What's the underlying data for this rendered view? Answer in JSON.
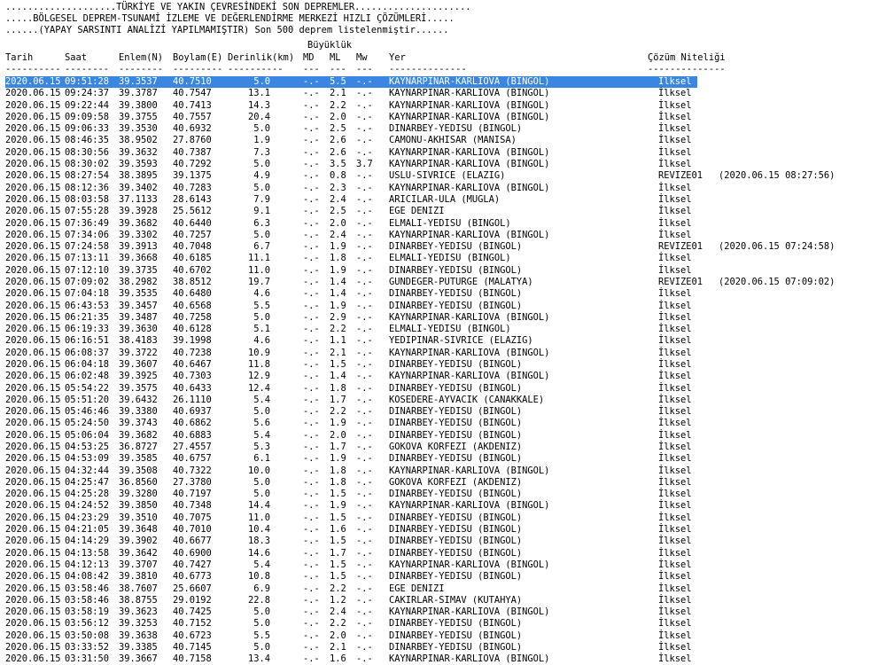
{
  "banner": [
    "....................TÜRKİYE VE YAKIN ÇEVRESİNDEKİ SON DEPREMLER.....................",
    ".....BÖLGESEL DEPREM-TSUNAMİ İZLEME VE DEĞERLENDİRME MERKEZİ HIZLI ÇÖZÜMLERİ.....",
    "......(YAPAY SARSINTI ANALİZİ YAPILMAMIŞTIR) Son 500 deprem listelenmiştir......"
  ],
  "magnitude_group": "Büyüklük",
  "headers": {
    "date": "Tarih",
    "time": "Saat",
    "lat": "Enlem(N)",
    "lon": "Boylam(E)",
    "depth": "Derinlik(km)",
    "md": "MD",
    "ml": "ML",
    "mw": "Mw",
    "place": "Yer",
    "quality": "Çözüm Niteliği"
  },
  "dashes": {
    "date": "----------",
    "time": "--------",
    "lat": "--------",
    "lon": "---------",
    "depth": "----------",
    "md": "---",
    "ml": "---",
    "mw": "---",
    "place": "--------------",
    "quality": "--------------"
  },
  "rows": [
    [
      "2020.06.15",
      "09:51:28",
      "39.3537",
      "40.7510",
      "5.0",
      "-.-",
      "5.5",
      "-.-",
      "KAYNARPINAR-KARLIOVA (BINGOL)",
      "İlksel",
      ""
    ],
    [
      "2020.06.15",
      "09:24:37",
      "39.3787",
      "40.7547",
      "13.1",
      "-.-",
      "2.1",
      "-.-",
      "KAYNARPINAR-KARLIOVA (BINGOL)",
      "İlksel",
      ""
    ],
    [
      "2020.06.15",
      "09:22:44",
      "39.3800",
      "40.7413",
      "14.3",
      "-.-",
      "2.2",
      "-.-",
      "KAYNARPINAR-KARLIOVA (BINGOL)",
      "İlksel",
      ""
    ],
    [
      "2020.06.15",
      "09:09:58",
      "39.3755",
      "40.7557",
      "20.4",
      "-.-",
      "2.0",
      "-.-",
      "KAYNARPINAR-KARLIOVA (BINGOL)",
      "İlksel",
      ""
    ],
    [
      "2020.06.15",
      "09:06:33",
      "39.3530",
      "40.6932",
      "5.0",
      "-.-",
      "2.5",
      "-.-",
      "DINARBEY-YEDISU (BINGOL)",
      "İlksel",
      ""
    ],
    [
      "2020.06.15",
      "08:46:35",
      "38.9502",
      "27.8760",
      "1.9",
      "-.-",
      "2.6",
      "-.-",
      "CAMONU-AKHISAR (MANISA)",
      "İlksel",
      ""
    ],
    [
      "2020.06.15",
      "08:30:56",
      "39.3632",
      "40.7387",
      "7.3",
      "-.-",
      "2.6",
      "-.-",
      "KAYNARPINAR-KARLIOVA (BINGOL)",
      "İlksel",
      ""
    ],
    [
      "2020.06.15",
      "08:30:02",
      "39.3593",
      "40.7292",
      "5.0",
      "-.-",
      "3.5",
      "3.7",
      "KAYNARPINAR-KARLIOVA (BINGOL)",
      "İlksel",
      ""
    ],
    [
      "2020.06.15",
      "08:27:54",
      "38.3895",
      "39.1375",
      "4.9",
      "-.-",
      "0.8",
      "-.-",
      "USLU-SIVRICE (ELAZIG)",
      "REVIZE01",
      "(2020.06.15 08:27:56)"
    ],
    [
      "2020.06.15",
      "08:12:36",
      "39.3402",
      "40.7283",
      "5.0",
      "-.-",
      "2.3",
      "-.-",
      "KAYNARPINAR-KARLIOVA (BINGOL)",
      "İlksel",
      ""
    ],
    [
      "2020.06.15",
      "08:03:58",
      "37.1133",
      "28.6143",
      "7.9",
      "-.-",
      "2.4",
      "-.-",
      "ARICILAR-ULA (MUGLA)",
      "İlksel",
      ""
    ],
    [
      "2020.06.15",
      "07:55:28",
      "39.3928",
      "25.5612",
      "9.1",
      "-.-",
      "2.5",
      "-.-",
      "EGE DENIZI",
      "İlksel",
      ""
    ],
    [
      "2020.06.15",
      "07:36:49",
      "39.3682",
      "40.6440",
      "6.3",
      "-.-",
      "2.0",
      "-.-",
      "ELMALI-YEDISU (BINGOL)",
      "İlksel",
      ""
    ],
    [
      "2020.06.15",
      "07:34:06",
      "39.3302",
      "40.7257",
      "5.0",
      "-.-",
      "2.4",
      "-.-",
      "KAYNARPINAR-KARLIOVA (BINGOL)",
      "İlksel",
      ""
    ],
    [
      "2020.06.15",
      "07:24:58",
      "39.3913",
      "40.7048",
      "6.7",
      "-.-",
      "1.9",
      "-.-",
      "DINARBEY-YEDISU (BINGOL)",
      "REVIZE01",
      "(2020.06.15 07:24:58)"
    ],
    [
      "2020.06.15",
      "07:13:11",
      "39.3668",
      "40.6185",
      "11.1",
      "-.-",
      "1.8",
      "-.-",
      "ELMALI-YEDISU (BINGOL)",
      "İlksel",
      ""
    ],
    [
      "2020.06.15",
      "07:12:10",
      "39.3735",
      "40.6702",
      "11.0",
      "-.-",
      "1.9",
      "-.-",
      "DINARBEY-YEDISU (BINGOL)",
      "İlksel",
      ""
    ],
    [
      "2020.06.15",
      "07:09:02",
      "38.2982",
      "38.8512",
      "19.7",
      "-.-",
      "1.4",
      "-.-",
      "GUNDEGER-PUTURGE (MALATYA)",
      "REVIZE01",
      "(2020.06.15 07:09:02)"
    ],
    [
      "2020.06.15",
      "07:04:18",
      "39.3535",
      "40.6480",
      "4.6",
      "-.-",
      "1.4",
      "-.-",
      "DINARBEY-YEDISU (BINGOL)",
      "İlksel",
      ""
    ],
    [
      "2020.06.15",
      "06:43:53",
      "39.3457",
      "40.6568",
      "5.5",
      "-.-",
      "1.9",
      "-.-",
      "DINARBEY-YEDISU (BINGOL)",
      "İlksel",
      ""
    ],
    [
      "2020.06.15",
      "06:21:35",
      "39.3487",
      "40.7258",
      "5.0",
      "-.-",
      "2.9",
      "-.-",
      "KAYNARPINAR-KARLIOVA (BINGOL)",
      "İlksel",
      ""
    ],
    [
      "2020.06.15",
      "06:19:33",
      "39.3630",
      "40.6128",
      "5.1",
      "-.-",
      "2.2",
      "-.-",
      "ELMALI-YEDISU (BINGOL)",
      "İlksel",
      ""
    ],
    [
      "2020.06.15",
      "06:16:51",
      "38.4183",
      "39.1998",
      "4.6",
      "-.-",
      "1.1",
      "-.-",
      "YEDIPINAR-SIVRICE (ELAZIG)",
      "İlksel",
      ""
    ],
    [
      "2020.06.15",
      "06:08:37",
      "39.3722",
      "40.7238",
      "10.9",
      "-.-",
      "2.1",
      "-.-",
      "KAYNARPINAR-KARLIOVA (BINGOL)",
      "İlksel",
      ""
    ],
    [
      "2020.06.15",
      "06:04:18",
      "39.3607",
      "40.6467",
      "11.8",
      "-.-",
      "1.5",
      "-.-",
      "DINARBEY-YEDISU (BINGOL)",
      "İlksel",
      ""
    ],
    [
      "2020.06.15",
      "06:02:48",
      "39.3925",
      "40.7303",
      "12.9",
      "-.-",
      "1.4",
      "-.-",
      "KAYNARPINAR-KARLIOVA (BINGOL)",
      "İlksel",
      ""
    ],
    [
      "2020.06.15",
      "05:54:22",
      "39.3575",
      "40.6433",
      "12.4",
      "-.-",
      "1.8",
      "-.-",
      "DINARBEY-YEDISU (BINGOL)",
      "İlksel",
      ""
    ],
    [
      "2020.06.15",
      "05:51:20",
      "39.6432",
      "26.1110",
      "5.4",
      "-.-",
      "1.7",
      "-.-",
      "KOSEDERE-AYVACIK (CANAKKALE)",
      "İlksel",
      ""
    ],
    [
      "2020.06.15",
      "05:46:46",
      "39.3380",
      "40.6937",
      "5.0",
      "-.-",
      "2.2",
      "-.-",
      "DINARBEY-YEDISU (BINGOL)",
      "İlksel",
      ""
    ],
    [
      "2020.06.15",
      "05:24:50",
      "39.3743",
      "40.6862",
      "5.6",
      "-.-",
      "1.9",
      "-.-",
      "DINARBEY-YEDISU (BINGOL)",
      "İlksel",
      ""
    ],
    [
      "2020.06.15",
      "05:06:04",
      "39.3682",
      "40.6883",
      "5.4",
      "-.-",
      "2.0",
      "-.-",
      "DINARBEY-YEDISU (BINGOL)",
      "İlksel",
      ""
    ],
    [
      "2020.06.15",
      "04:53:25",
      "36.8727",
      "27.4557",
      "5.3",
      "-.-",
      "1.7",
      "-.-",
      "GOKOVA KORFEZI (AKDENIZ)",
      "İlksel",
      ""
    ],
    [
      "2020.06.15",
      "04:53:09",
      "39.3585",
      "40.6757",
      "6.1",
      "-.-",
      "1.9",
      "-.-",
      "DINARBEY-YEDISU (BINGOL)",
      "İlksel",
      ""
    ],
    [
      "2020.06.15",
      "04:32:44",
      "39.3508",
      "40.7322",
      "10.0",
      "-.-",
      "1.8",
      "-.-",
      "KAYNARPINAR-KARLIOVA (BINGOL)",
      "İlksel",
      ""
    ],
    [
      "2020.06.15",
      "04:25:47",
      "36.8560",
      "27.3780",
      "5.0",
      "-.-",
      "1.8",
      "-.-",
      "GOKOVA KORFEZI (AKDENIZ)",
      "İlksel",
      ""
    ],
    [
      "2020.06.15",
      "04:25:28",
      "39.3280",
      "40.7197",
      "5.0",
      "-.-",
      "1.5",
      "-.-",
      "DINARBEY-YEDISU (BINGOL)",
      "İlksel",
      ""
    ],
    [
      "2020.06.15",
      "04:24:52",
      "39.3850",
      "40.7348",
      "14.4",
      "-.-",
      "1.9",
      "-.-",
      "KAYNARPINAR-KARLIOVA (BINGOL)",
      "İlksel",
      ""
    ],
    [
      "2020.06.15",
      "04:23:29",
      "39.3510",
      "40.7075",
      "11.0",
      "-.-",
      "1.5",
      "-.-",
      "DINARBEY-YEDISU (BINGOL)",
      "İlksel",
      ""
    ],
    [
      "2020.06.15",
      "04:21:05",
      "39.3648",
      "40.7010",
      "10.4",
      "-.-",
      "1.6",
      "-.-",
      "DINARBEY-YEDISU (BINGOL)",
      "İlksel",
      ""
    ],
    [
      "2020.06.15",
      "04:14:29",
      "39.3902",
      "40.6677",
      "18.3",
      "-.-",
      "1.5",
      "-.-",
      "DINARBEY-YEDISU (BINGOL)",
      "İlksel",
      ""
    ],
    [
      "2020.06.15",
      "04:13:58",
      "39.3642",
      "40.6900",
      "14.6",
      "-.-",
      "1.7",
      "-.-",
      "DINARBEY-YEDISU (BINGOL)",
      "İlksel",
      ""
    ],
    [
      "2020.06.15",
      "04:12:13",
      "39.3707",
      "40.7427",
      "5.4",
      "-.-",
      "1.5",
      "-.-",
      "KAYNARPINAR-KARLIOVA (BINGOL)",
      "İlksel",
      ""
    ],
    [
      "2020.06.15",
      "04:08:42",
      "39.3810",
      "40.6773",
      "10.8",
      "-.-",
      "1.5",
      "-.-",
      "DINARBEY-YEDISU (BINGOL)",
      "İlksel",
      ""
    ],
    [
      "2020.06.15",
      "03:58:46",
      "38.7607",
      "25.6607",
      "6.9",
      "-.-",
      "2.2",
      "-.-",
      "EGE DENIZI",
      "İlksel",
      ""
    ],
    [
      "2020.06.15",
      "03:58:46",
      "38.8755",
      "29.0192",
      "22.8",
      "-.-",
      "1.2",
      "-.-",
      "CAKIRLAR-SIMAV (KUTAHYA)",
      "İlksel",
      ""
    ],
    [
      "2020.06.15",
      "03:58:19",
      "39.3623",
      "40.7425",
      "5.0",
      "-.-",
      "2.4",
      "-.-",
      "KAYNARPINAR-KARLIOVA (BINGOL)",
      "İlksel",
      ""
    ],
    [
      "2020.06.15",
      "03:56:12",
      "39.3253",
      "40.7152",
      "5.0",
      "-.-",
      "2.2",
      "-.-",
      "DINARBEY-YEDISU (BINGOL)",
      "İlksel",
      ""
    ],
    [
      "2020.06.15",
      "03:50:08",
      "39.3638",
      "40.6723",
      "5.5",
      "-.-",
      "2.0",
      "-.-",
      "DINARBEY-YEDISU (BINGOL)",
      "İlksel",
      ""
    ],
    [
      "2020.06.15",
      "03:33:52",
      "39.3385",
      "40.7145",
      "5.0",
      "-.-",
      "2.1",
      "-.-",
      "DINARBEY-YEDISU (BINGOL)",
      "İlksel",
      ""
    ],
    [
      "2020.06.15",
      "03:31:50",
      "39.3667",
      "40.7158",
      "13.4",
      "-.-",
      "1.6",
      "-.-",
      "KAYNARPINAR-KARLIOVA (BINGOL)",
      "İlksel",
      ""
    ]
  ],
  "selected_row": 0
}
